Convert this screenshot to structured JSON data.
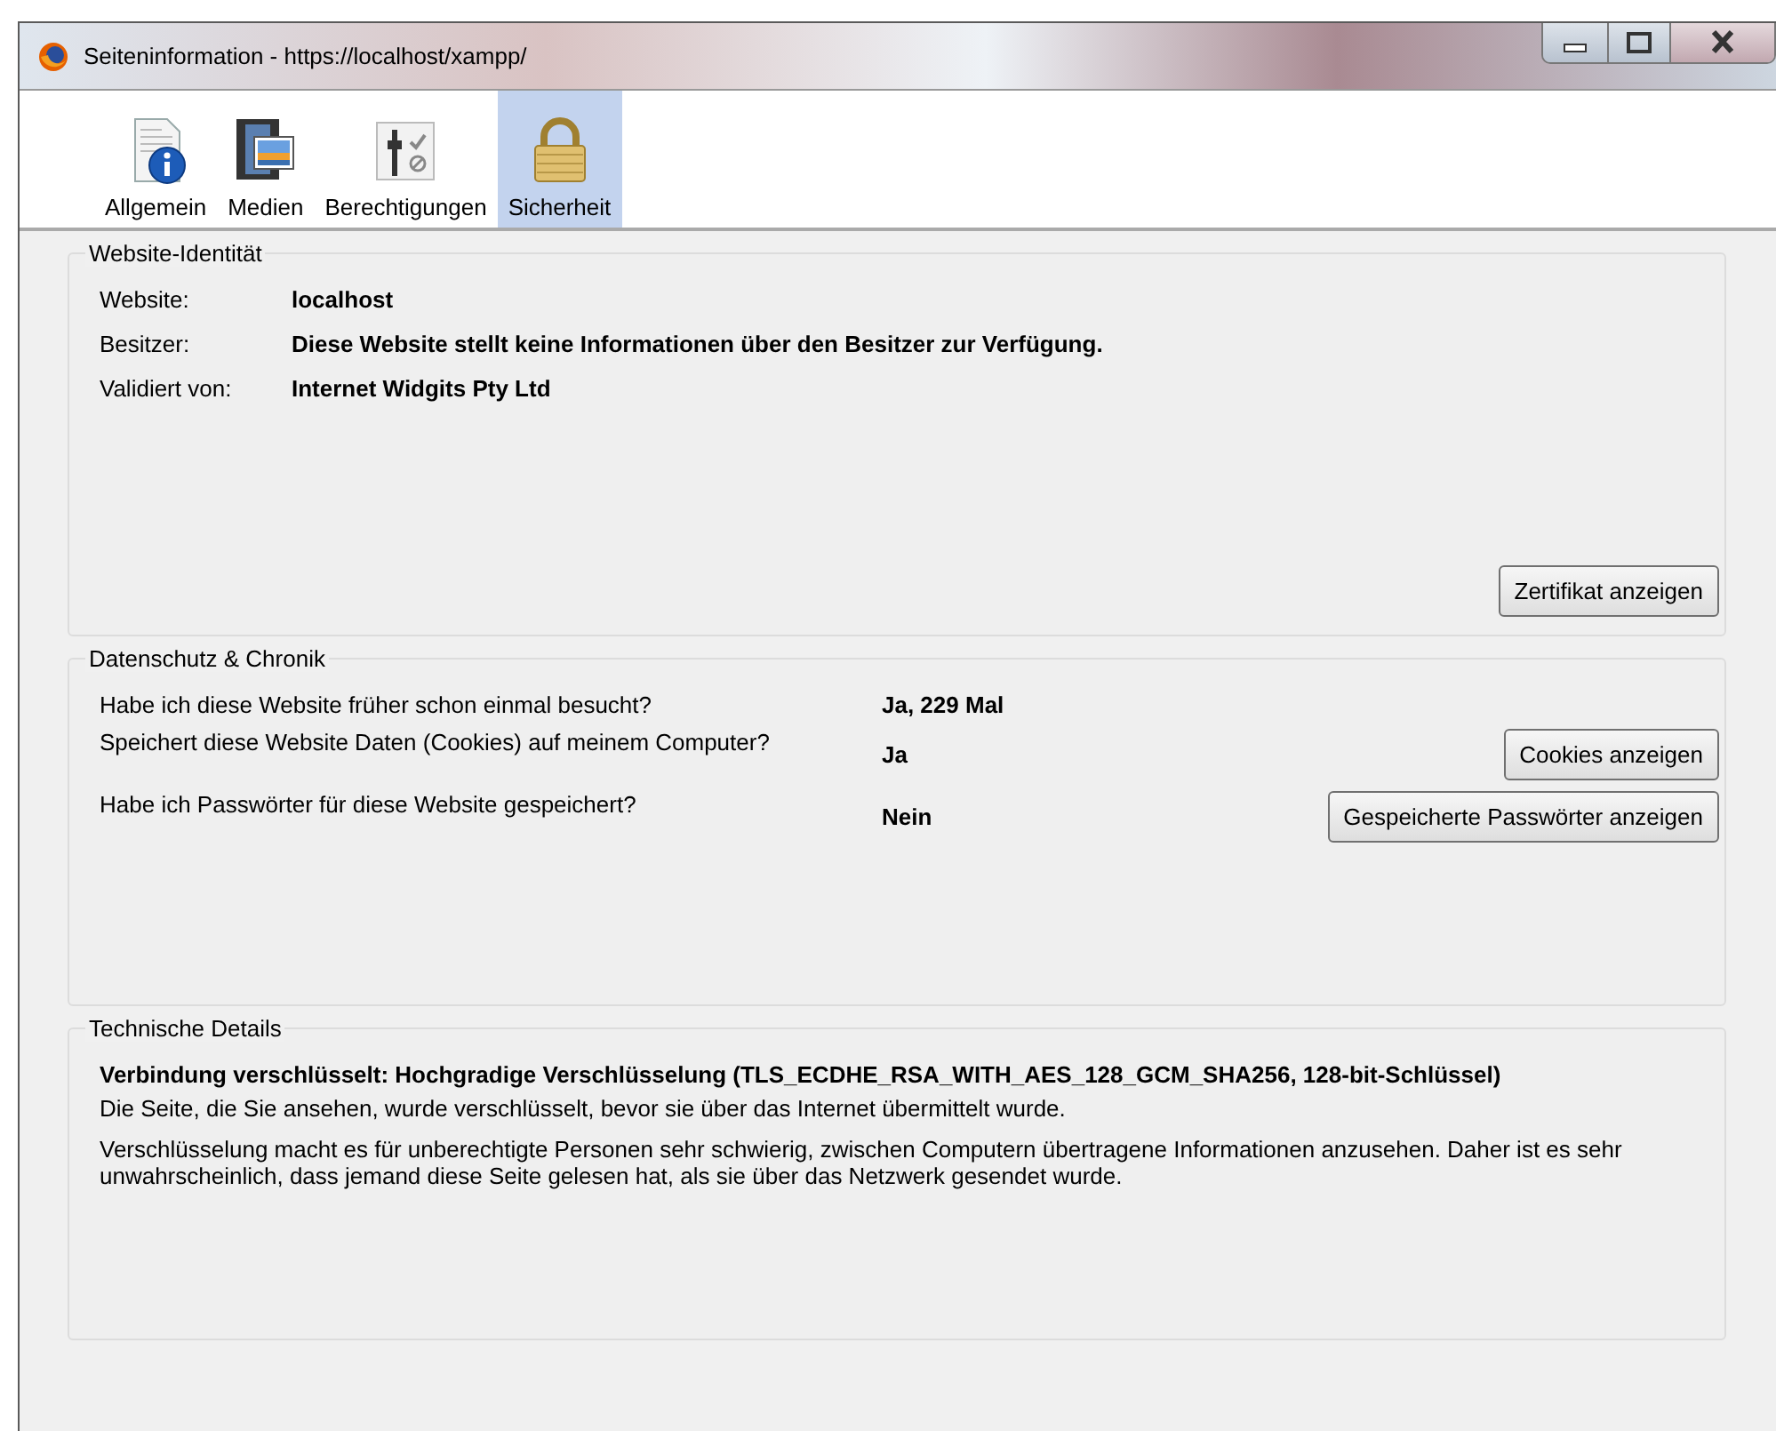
{
  "window": {
    "title": "Seiteninformation - https://localhost/xampp/"
  },
  "tabs": [
    {
      "label": "Allgemein",
      "kind": "info",
      "selected": false
    },
    {
      "label": "Medien",
      "kind": "media",
      "selected": false
    },
    {
      "label": "Berechtigungen",
      "kind": "permissions",
      "selected": false
    },
    {
      "label": "Sicherheit",
      "kind": "lock",
      "selected": true
    }
  ],
  "identity": {
    "title": "Website-Identität",
    "rows": [
      {
        "label": "Website:",
        "value": "localhost"
      },
      {
        "label": "Besitzer:",
        "value": "Diese Website stellt keine Informationen über den Besitzer zur Verfügung."
      },
      {
        "label": "Validiert von:",
        "value": "Internet Widgits Pty Ltd"
      }
    ],
    "button": "Zertifikat anzeigen"
  },
  "privacy": {
    "title": "Datenschutz & Chronik",
    "rows": [
      {
        "question": "Habe ich diese Website früher schon einmal besucht?",
        "answer": "Ja, 229 Mal"
      },
      {
        "question": "Speichert diese Website Daten (Cookies) auf meinem Computer?",
        "answer": "Ja",
        "button": "Cookies anzeigen"
      },
      {
        "question": "Habe ich Passwörter für diese Website gespeichert?",
        "answer": "Nein",
        "button": "Gespeicherte Passwörter anzeigen"
      }
    ]
  },
  "technical": {
    "title": "Technische Details",
    "headline": "Verbindung verschlüsselt: Hochgradige Verschlüsselung (TLS_ECDHE_RSA_WITH_AES_128_GCM_SHA256, 128-bit-Schlüssel)",
    "paragraphs": [
      "Die Seite, die Sie ansehen, wurde verschlüsselt, bevor sie über das Internet übermittelt wurde.",
      "Verschlüsselung macht es für unberechtigte Personen sehr schwierig, zwischen Computern übertragene Informationen anzusehen. Daher ist es sehr unwahrscheinlich, dass jemand diese Seite gelesen hat, als sie über das Netzwerk gesendet wurde."
    ]
  }
}
